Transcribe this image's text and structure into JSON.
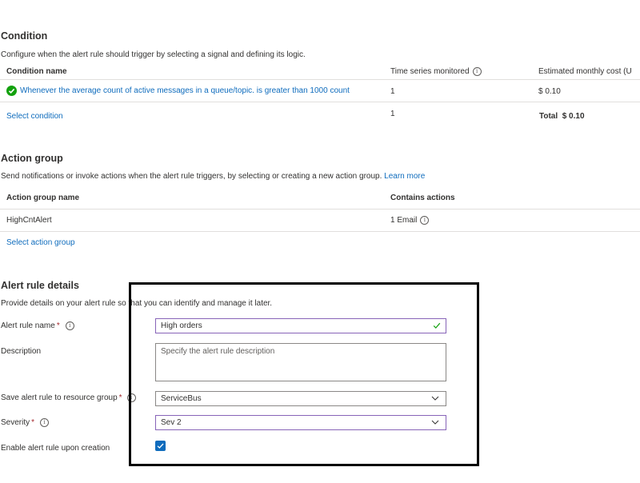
{
  "condition": {
    "title": "Condition",
    "description": "Configure when the alert rule should trigger by selecting a signal and defining its logic.",
    "columns": [
      "Condition name",
      "Time series monitored",
      "Estimated monthly cost (U"
    ],
    "row": {
      "name": "Whenever the average count of active messages in a queue/topic. is greater than 1000 count",
      "series": "1",
      "cost": "$ 0.10"
    },
    "select_label": "Select condition",
    "select_series": "1",
    "total_label": "Total",
    "total_value": "$ 0.10"
  },
  "action_group": {
    "title": "Action group",
    "description": "Send notifications or invoke actions when the alert rule triggers, by selecting or creating a new action group.",
    "learn_more": "Learn more",
    "columns": [
      "Action group name",
      "Contains actions"
    ],
    "row": {
      "name": "HighCntAlert",
      "actions": "1 Email"
    },
    "select_label": "Select action group"
  },
  "details": {
    "title": "Alert rule details",
    "description": "Provide details on your alert rule so that you can identify and manage it later.",
    "name_label": "Alert rule name",
    "name_value": "High orders",
    "description_label": "Description",
    "description_placeholder": "Specify the alert rule description",
    "rg_label": "Save alert rule to resource group",
    "rg_value": "ServiceBus",
    "severity_label": "Severity",
    "severity_value": "Sev 2",
    "enable_label": "Enable alert rule upon creation",
    "enable_checked": true,
    "required_mark": "*",
    "info_glyph": "i"
  },
  "colors": {
    "link": "#0f6cbd",
    "focus_border": "#8764b8",
    "success": "#13a10e",
    "checkbox": "#0f6cbd",
    "required": "#a4262c"
  }
}
